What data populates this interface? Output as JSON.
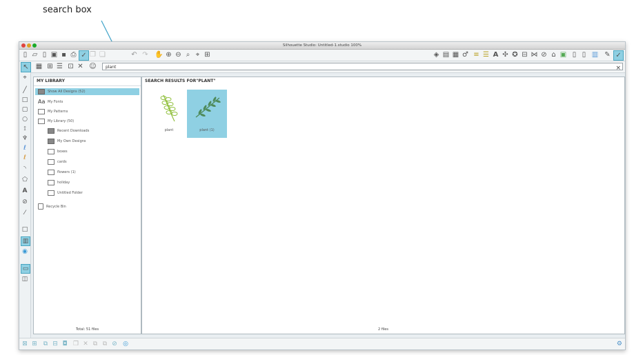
{
  "annotation": {
    "label": "search box"
  },
  "window": {
    "title": "Silhouette Studio: Untitled-1.studio 100%"
  },
  "toolbar_main": {
    "left_icons": [
      "new-doc-icon",
      "open-folder-icon",
      "open-file-icon",
      "save-icon",
      "save-library-icon",
      "print-icon",
      "send-to-cutter-icon",
      "copy-icon",
      "paste-icon",
      "undo-icon",
      "redo-icon",
      "pan-icon",
      "zoom-in-icon",
      "zoom-out-icon",
      "zoom-drag-icon",
      "zoom-fit-icon",
      "fit-page-icon"
    ],
    "right_icons": [
      "fill-color-icon",
      "line-color-icon",
      "fill-pattern-icon",
      "line-style-icon",
      "align-icon",
      "replicate-icon",
      "text-style-icon",
      "transform-icon",
      "offset-icon",
      "trace-icon",
      "modify-icon",
      "point-edit-icon",
      "design-store-icon",
      "page-setup-icon",
      "cut-settings-icon",
      "grid-icon",
      "sketch-icon",
      "library-icon"
    ]
  },
  "search": {
    "value": "plant",
    "clear_label": "×"
  },
  "library": {
    "header": "MY LIBRARY",
    "items": [
      {
        "label": "Show All Designs (52)"
      },
      {
        "label": "My Fonts"
      },
      {
        "label": "My Patterns"
      },
      {
        "label": "My Library (50)"
      },
      {
        "label": "Recent Downloads"
      },
      {
        "label": "My Own Designs"
      },
      {
        "label": "boxes"
      },
      {
        "label": "cards"
      },
      {
        "label": "flowers (1)"
      },
      {
        "label": "holiday"
      },
      {
        "label": "Untitled Folder"
      },
      {
        "label": "Recycle Bin"
      }
    ],
    "total": "Total: 51 files"
  },
  "results": {
    "header": "SEARCH RESULTS FOR\"PLANT\"",
    "items": [
      {
        "label": "plant"
      },
      {
        "label": "plant (1)"
      }
    ],
    "count": "2 files"
  },
  "colors": {
    "accent": "#8fd0e3",
    "annotation": "#4aa8cc"
  }
}
